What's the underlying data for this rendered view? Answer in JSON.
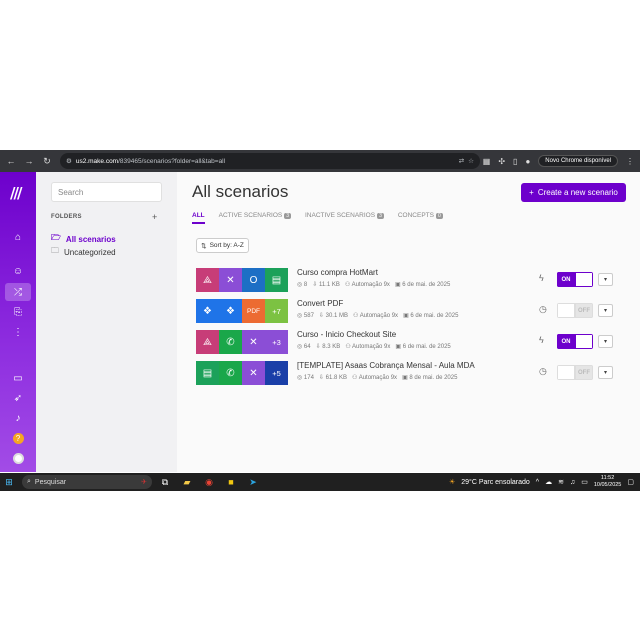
{
  "browser": {
    "host": "us2.make.com",
    "path": "/839465/scenarios?folder=all&tab=all",
    "chrome_badge": "Novo Chrome disponível"
  },
  "sidebar": {
    "search_placeholder": "Search",
    "folders_label": "FOLDERS",
    "folders": [
      {
        "label": "All scenarios",
        "active": true
      },
      {
        "label": "Uncategorized",
        "active": false
      }
    ]
  },
  "main": {
    "title": "All scenarios",
    "create_label": "Create a new scenario",
    "tabs": [
      {
        "label": "ALL",
        "count": "",
        "active": true
      },
      {
        "label": "ACTIVE SCENARIOS",
        "count": "3",
        "active": false
      },
      {
        "label": "INACTIVE SCENARIOS",
        "count": "3",
        "active": false
      },
      {
        "label": "CONCEPTS",
        "count": "0",
        "active": false
      }
    ],
    "sort_label": "Sort by: A-Z"
  },
  "scenarios": [
    {
      "name": "Curso compra HotMart",
      "ops": "8",
      "size": "11.1 KB",
      "team": "Automação 9x",
      "date": "6 de mai. de 2025",
      "toggle": "ON",
      "enabled": true,
      "tiles": [
        {
          "icon": "webhook-icon",
          "color": "#c73d78",
          "glyph": "⟁"
        },
        {
          "icon": "tools-icon",
          "color": "#8b4ed6",
          "glyph": "✕"
        },
        {
          "icon": "outlook-icon",
          "color": "#1d6fc5",
          "glyph": "O"
        },
        {
          "icon": "sheets-icon",
          "color": "#1ca15a",
          "glyph": "▤"
        }
      ],
      "more": ""
    },
    {
      "name": "Convert PDF",
      "ops": "587",
      "size": "30.1 MB",
      "team": "Automação 9x",
      "date": "6 de mai. de 2025",
      "toggle": "OFF",
      "enabled": false,
      "tiles": [
        {
          "icon": "dropbox-icon",
          "color": "#1f74e8",
          "glyph": "❖"
        },
        {
          "icon": "dropbox-icon",
          "color": "#1f74e8",
          "glyph": "❖"
        },
        {
          "icon": "pdf-icon",
          "color": "#ec6b32",
          "glyph": "PDF"
        }
      ],
      "more": "+7",
      "more_color": "#7cc242"
    },
    {
      "name": "Curso - Inicio Checkout Site",
      "ops": "64",
      "size": "8.3 KB",
      "team": "Automação 9x",
      "date": "6 de mai. de 2025",
      "toggle": "ON",
      "enabled": true,
      "tiles": [
        {
          "icon": "webhook-icon",
          "color": "#c73d78",
          "glyph": "⟁"
        },
        {
          "icon": "whatsapp-icon",
          "color": "#1aa74a",
          "glyph": "✆"
        },
        {
          "icon": "tools-icon",
          "color": "#8b4ed6",
          "glyph": "✕"
        }
      ],
      "more": "+3",
      "more_color": "#8b4ed6"
    },
    {
      "name": "[TEMPLATE] Asaas Cobrança Mensal - Aula MDA",
      "ops": "174",
      "size": "61.8 KB",
      "team": "Automação 9x",
      "date": "8 de mai. de 2025",
      "toggle": "OFF",
      "enabled": false,
      "tiles": [
        {
          "icon": "sheets-icon",
          "color": "#1ca15a",
          "glyph": "▤"
        },
        {
          "icon": "whatsapp-icon",
          "color": "#1aa74a",
          "glyph": "✆"
        },
        {
          "icon": "tools-icon",
          "color": "#8b4ed6",
          "glyph": "✕"
        }
      ],
      "more": "+5",
      "more_color": "#1a3fa8"
    }
  ],
  "taskbar": {
    "search_label": "Pesquisar",
    "weather": "29°C  Parc ensolarado",
    "time": "11:52",
    "date": "10/05/2025"
  },
  "colors": {
    "accent": "#6d00cc"
  }
}
